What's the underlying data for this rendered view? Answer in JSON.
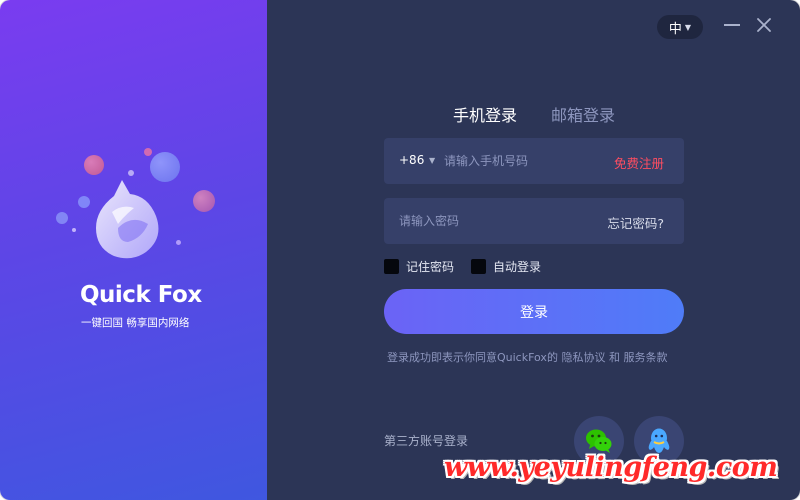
{
  "brand": {
    "name": "Quick Fox",
    "slogan": "一键回国  畅享国内网络",
    "logo_icon": "fox-logo-icon"
  },
  "window_controls": {
    "language": "中",
    "minimize_icon": "minimize-icon",
    "close_icon": "close-icon"
  },
  "tabs": [
    {
      "label": "手机登录",
      "active": true
    },
    {
      "label": "邮箱登录",
      "active": false
    }
  ],
  "phone": {
    "country_code": "+86",
    "placeholder": "请输入手机号码",
    "value": "",
    "register_label": "免费注册"
  },
  "password": {
    "placeholder": "请输入密码",
    "value": "",
    "forgot_label": "忘记密码?"
  },
  "options": {
    "remember_label": "记住密码",
    "remember_checked": false,
    "auto_label": "自动登录",
    "auto_checked": false
  },
  "login_button": "登录",
  "agreement": {
    "text": "登录成功即表示你同意QuickFox的",
    "privacy": "隐私协议",
    "and": "和",
    "terms": "服务条款"
  },
  "third_party": {
    "label": "第三方账号登录",
    "providers": [
      {
        "name": "wechat",
        "icon": "wechat-icon",
        "color": "#2dc100"
      },
      {
        "name": "qq",
        "icon": "qq-icon",
        "color": "#4aa8ff"
      }
    ]
  },
  "watermark": "www.yeyulingfeng.com",
  "colors": {
    "left_gradient_start": "#7a3cf0",
    "left_gradient_end": "#3f57e0",
    "panel_bg": "#2c3556",
    "field_bg": "#364069",
    "accent_red": "#ff4d61",
    "button_gradient_start": "#6b63f6",
    "button_gradient_end": "#4f7cf8"
  }
}
